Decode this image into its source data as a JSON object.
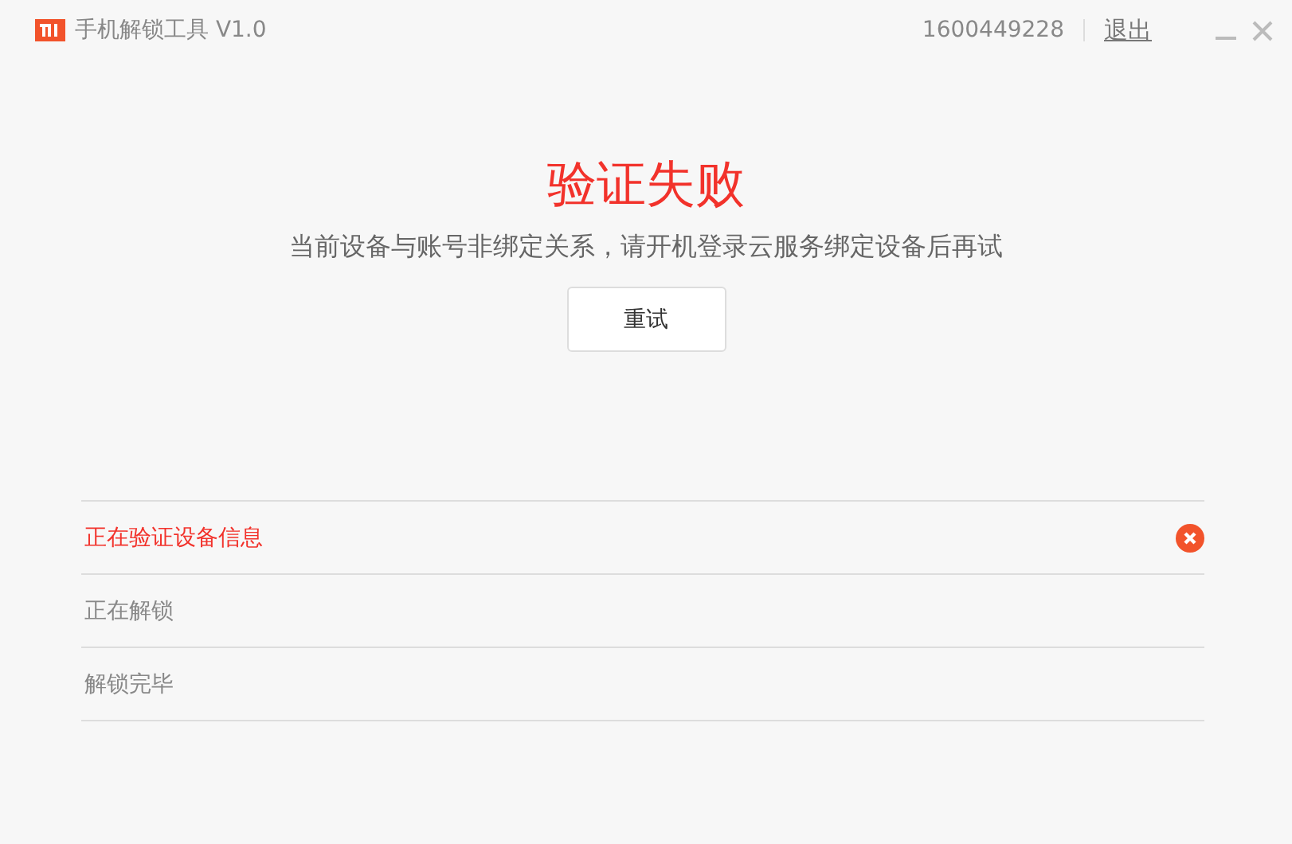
{
  "window": {
    "title": "手机解锁工具 V1.0",
    "account": "1600449228",
    "logout": "退出"
  },
  "result": {
    "title": "验证失败",
    "message": "当前设备与账号非绑定关系，请开机登录云服务绑定设备后再试",
    "button": "重试"
  },
  "steps": [
    {
      "label": "正在验证设备信息",
      "failed": true
    },
    {
      "label": "正在解锁",
      "failed": false
    },
    {
      "label": "解锁完毕",
      "failed": false
    }
  ]
}
